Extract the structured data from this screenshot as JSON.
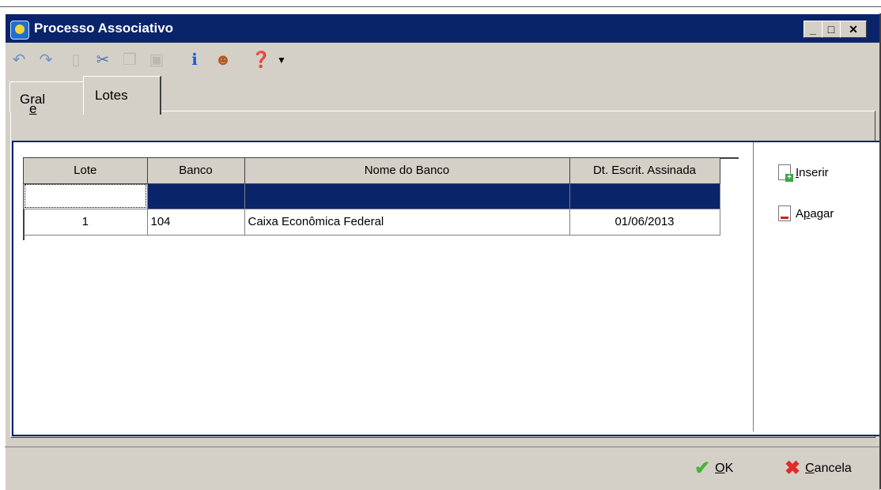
{
  "window": {
    "title": "Processo Associativo",
    "controls": [
      "minimize",
      "maximize",
      "close"
    ]
  },
  "toolbar": {
    "icons": [
      "undo-icon",
      "redo-icon",
      "new-document-icon",
      "cut-icon",
      "copy-icon",
      "paste-icon",
      "info-icon",
      "user-icon",
      "help-icon",
      "dropdown-arrow-icon"
    ]
  },
  "tabs": [
    {
      "label": "Geral",
      "mnemonic": "e",
      "active": false
    },
    {
      "label": "Lotes",
      "active": true
    }
  ],
  "grid": {
    "columns": [
      "Lote",
      "Banco",
      "Nome do Banco",
      "Dt. Escrit. Assinada"
    ],
    "rows": [
      {
        "lote": "",
        "banco": "",
        "nome": "",
        "data": "",
        "selected": true
      },
      {
        "lote": "1",
        "banco": "104",
        "nome": "Caixa Econômica Federal",
        "data": "01/06/2013",
        "selected": false
      }
    ]
  },
  "actions": {
    "inserir": {
      "pre": "",
      "key": "I",
      "post": "nserir"
    },
    "apagar": {
      "pre": "A",
      "key": "p",
      "post": "agar"
    }
  },
  "footer": {
    "ok": {
      "key": "O",
      "post": "K"
    },
    "cancela": {
      "key": "C",
      "post": "ancela"
    }
  },
  "colors": {
    "titlebar": "#0a246a",
    "selection": "#0a246a",
    "face": "#d4d0c8"
  }
}
